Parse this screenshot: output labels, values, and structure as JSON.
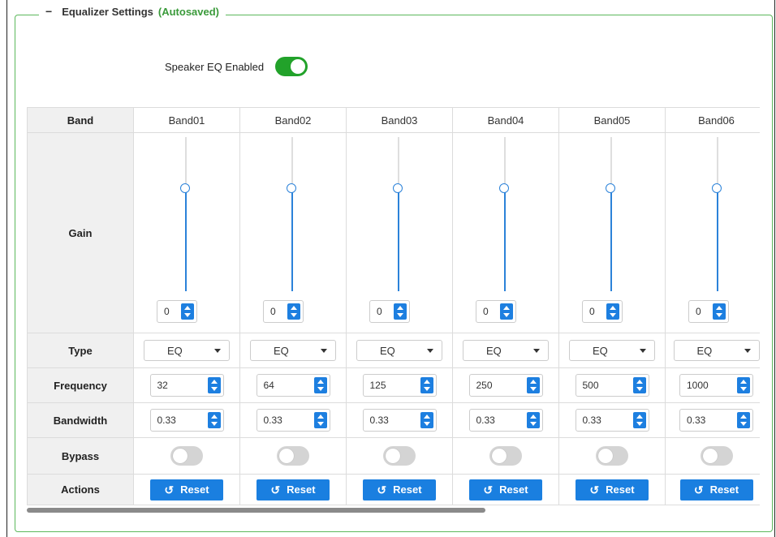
{
  "fieldset": {
    "collapse_symbol": "−",
    "title": "Equalizer Settings",
    "status": "(Autosaved)",
    "status_color": "#3a9a3a"
  },
  "speaker_eq": {
    "label": "Speaker EQ Enabled",
    "enabled": true,
    "on_color": "#22a22a"
  },
  "table": {
    "row_headers": {
      "band": "Band",
      "gain": "Gain",
      "type": "Type",
      "frequency": "Frequency",
      "bandwidth": "Bandwidth",
      "bypass": "Bypass",
      "actions": "Actions"
    },
    "reset_label": "Reset",
    "accent_color": "#1a7fe0",
    "bands": [
      {
        "name": "Band01",
        "gain": "0",
        "gain_level": 0.5,
        "type": "EQ",
        "frequency": "32",
        "bandwidth": "0.33",
        "bypass": false
      },
      {
        "name": "Band02",
        "gain": "0",
        "gain_level": 0.5,
        "type": "EQ",
        "frequency": "64",
        "bandwidth": "0.33",
        "bypass": false
      },
      {
        "name": "Band03",
        "gain": "0",
        "gain_level": 0.5,
        "type": "EQ",
        "frequency": "125",
        "bandwidth": "0.33",
        "bypass": false
      },
      {
        "name": "Band04",
        "gain": "0",
        "gain_level": 0.5,
        "type": "EQ",
        "frequency": "250",
        "bandwidth": "0.33",
        "bypass": false
      },
      {
        "name": "Band05",
        "gain": "0",
        "gain_level": 0.5,
        "type": "EQ",
        "frequency": "500",
        "bandwidth": "0.33",
        "bypass": false
      },
      {
        "name": "Band06",
        "gain": "0",
        "gain_level": 0.5,
        "type": "EQ",
        "frequency": "1000",
        "bandwidth": "0.33",
        "bypass": false
      }
    ]
  }
}
